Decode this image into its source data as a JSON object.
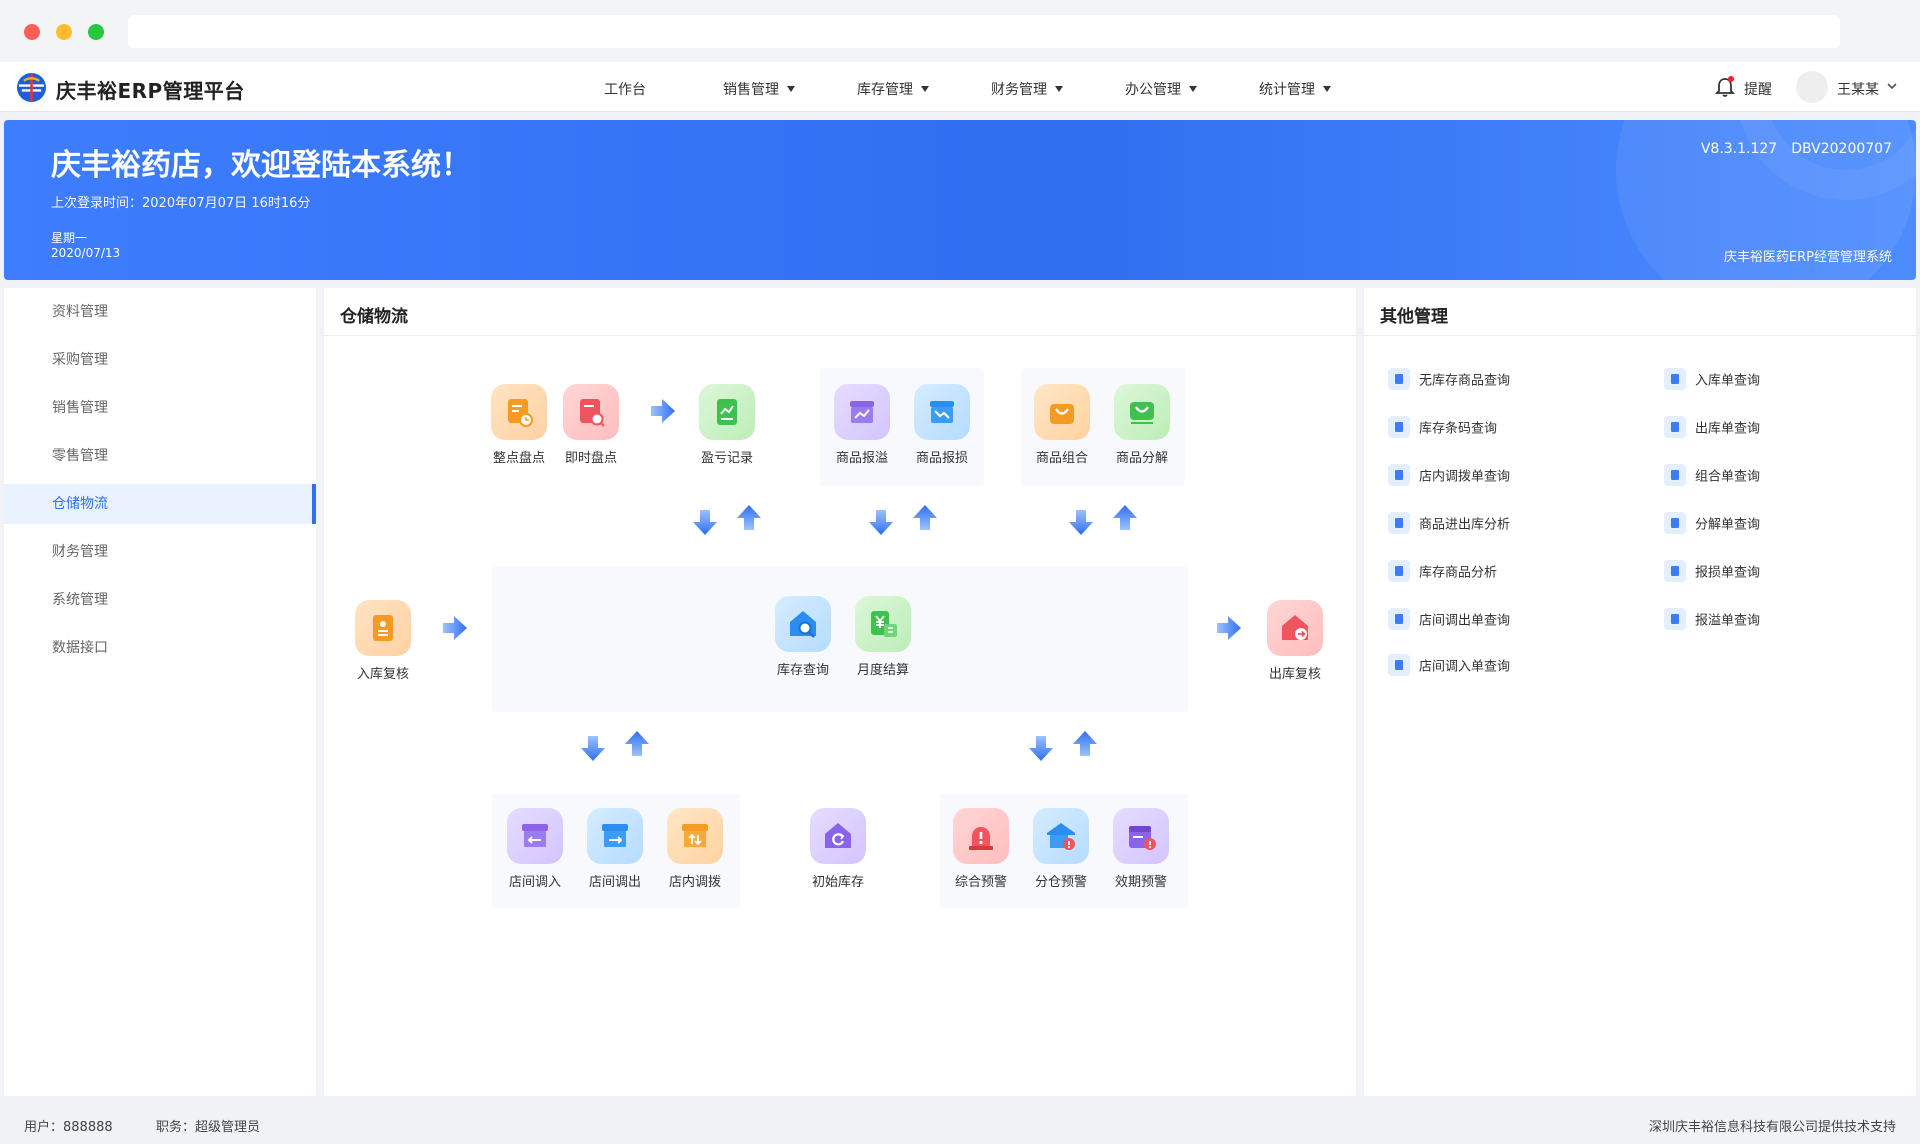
{
  "app": {
    "brand": "庆丰裕ERP管理平台"
  },
  "nav": {
    "items": [
      {
        "label": "工作台"
      },
      {
        "label": "销售管理"
      },
      {
        "label": "库存管理"
      },
      {
        "label": "财务管理"
      },
      {
        "label": "办公管理"
      },
      {
        "label": "统计管理"
      }
    ],
    "reminder": "提醒",
    "user": "王某某"
  },
  "banner": {
    "welcome": "庆丰裕药店，欢迎登陆本系统！",
    "last_login": "上次登录时间：2020年07月07日 16时16分",
    "weekday": "星期一",
    "date": "2020/07/13",
    "version": "V8.3.1.127　DBV20200707",
    "system_name": "庆丰裕医药ERP经营管理系统"
  },
  "sidebar": {
    "items": [
      {
        "label": "资料管理"
      },
      {
        "label": "采购管理"
      },
      {
        "label": "销售管理"
      },
      {
        "label": "零售管理"
      },
      {
        "label": "仓储物流"
      },
      {
        "label": "财务管理"
      },
      {
        "label": "系统管理"
      },
      {
        "label": "数据接口"
      }
    ],
    "active": "仓储物流"
  },
  "storage": {
    "title": "仓储物流",
    "tiles": {
      "inventory_check": "整点盘点",
      "instant_check": "即时盘点",
      "profit_loss": "盈亏记录",
      "overflow_report": "商品报溢",
      "damage_report": "商品报损",
      "combine": "商品组合",
      "split": "商品分解",
      "inbound_review": "入库复核",
      "stock_query": "库存查询",
      "monthly_close": "月度结算",
      "outbound_review": "出库复核",
      "transfer_in": "店间调入",
      "transfer_out": "店间调出",
      "internal_transfer": "店内调拨",
      "initial_stock": "初始库存",
      "general_alert": "综合预警",
      "warehouse_alert": "分仓预警",
      "expiry_alert": "效期预警"
    }
  },
  "other": {
    "title": "其他管理",
    "left": [
      "无库存商品查询",
      "库存条码查询",
      "店内调拨单查询",
      "商品进出库分析",
      "库存商品分析",
      "店间调出单查询",
      "店间调入单查询"
    ],
    "right": [
      "入库单查询",
      "出库单查询",
      "组合单查询",
      "分解单查询",
      "报损单查询",
      "报溢单查询"
    ]
  },
  "footer": {
    "user": "用户：888888",
    "role": "职务：超级管理员",
    "support": "深圳庆丰裕信息科技有限公司提供技术支持"
  },
  "colors": {
    "primary": "#2f6ff0",
    "banner_start": "#3f7dff",
    "sidebar_active_bg": "#eaf2ff"
  }
}
